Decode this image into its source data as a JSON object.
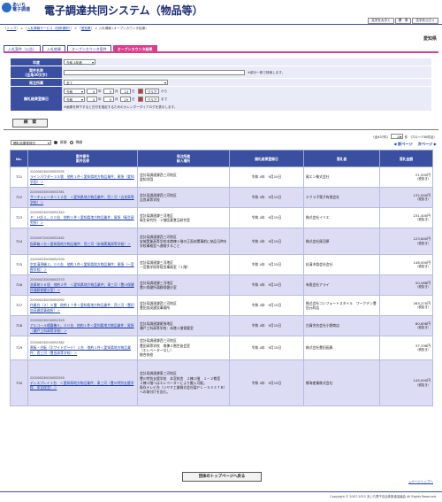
{
  "header": {
    "logo_line1": "あいち",
    "logo_line2": "電子調達",
    "title": "電子調達共同システム（物品等）",
    "font_buttons": [
      "文字を大きく",
      "標　準",
      "文字を小さく"
    ]
  },
  "breadcrumb": {
    "home": "トップ",
    "sep1": " > ",
    "service": "入札情報サービス（団体選択）",
    "sep2": " > ",
    "prefecture": "愛知県",
    "sep3": " > 入札情報 ",
    "current": "オープンカウンタ結果"
  },
  "region": "愛知県",
  "tabs": [
    "入札案件（公告）",
    "入札結果",
    "オープンカウンタ案件",
    "オープンカウンタ結果"
  ],
  "search": {
    "labels": {
      "year": "年度",
      "case_name": "案件名称",
      "case_name_sub": "(全角30文字)",
      "org": "発注所属",
      "date": "開札結果登録日"
    },
    "year_value": "令和 4年度",
    "case_name_note": "※部分一致で検索します。",
    "org_value": "全て",
    "date_from": {
      "era": "令和",
      "y": "4",
      "y_unit": "年",
      "m": "9",
      "m_unit": "月",
      "d": "13",
      "d_unit": "日",
      "clear": "クリア",
      "suffix": "から"
    },
    "date_to": {
      "era": "令和",
      "y": "4",
      "y_unit": "年",
      "m": "9",
      "m_unit": "月",
      "d": "29",
      "d_unit": "日",
      "clear": "クリア",
      "suffix": "まで"
    },
    "date_note": "※画像を押下すると日付を指定するためのカレンダーダイアログを表示します。",
    "button": "検　索"
  },
  "sort": {
    "field": "開札結果登録日",
    "asc": "昇順",
    "desc": "降順"
  },
  "paging": {
    "count": "（全437件）",
    "per_page": "10",
    "per_page_unit": "件",
    "range": "（721～730件目）",
    "prev": "前ページ",
    "next": "次ページ"
  },
  "table": {
    "headers": [
      "No.",
      "案件番号\n案件名称",
      "発注所属\n納入場所",
      "開札結果登録日",
      "落札者",
      "落札金額"
    ],
    "rows": [
      {
        "no": "721",
        "id": "220000230000053935",
        "name": "ラインパウダー３５袋　他約１件＜愛知県地方物品業件；尾張（愛知学園）＞",
        "org": "会計局調達課西三河地区\n愛知学園",
        "date": "令和 4年　9月15日",
        "winner": "尾エン株式会社",
        "amount": "21,000円",
        "note": "（税抜き）"
      },
      {
        "no": "722",
        "id": "220000230000052361",
        "name": "サーキュレーター１２台　＜愛知県地方物品業件；西三河（吉良高等学校）＞",
        "org": "会計局調達課西三河地区\n吉良高等学校",
        "date": "令和 4年　9月15日",
        "winner": "テクラ子電子有限会社",
        "amount": "132,000円",
        "note": "（税抜き）"
      },
      {
        "no": "723",
        "id": "220000230000052343",
        "name": "Ｐ：Ｈ計１，００台　他約１件＜愛知県地方物品業件；尾張（衛生研究所）＞",
        "org": "会計局調達課三河地区\n衛生研究所　２階医薬食品研究室",
        "date": "令和 4年　9月15日",
        "winner": "株式会社イリエ",
        "amount": "231,400円",
        "note": "（税抜き）"
      },
      {
        "no": "724",
        "id": "220000720000052462",
        "name": "指車箱１台＜愛知県地方物品業件；西三河（安城実業高等学校）＞",
        "org": "会計局調達課西三河地区\n安城実業高等学校本館棟１階の正面玄関事前に納品日時を学校事務室へ連絡すること",
        "date": "令和 4年　9月15日",
        "winner": "株式会社尾羽原",
        "amount": "123,840円",
        "note": "（税抜き）"
      },
      {
        "no": "725",
        "id": "220000230000052500",
        "name": "空気清浄機２，００台　他約１件＜愛知県地方物品業件；尾張（一宮聾学校）＞",
        "org": "会計局調達課三河地区\n一宮聾学校寄宿舎事務室（１階）",
        "date": "令和 4年　9月15日",
        "winner": "松清木県会社会社",
        "amount": "148,000円",
        "note": "（税抜き）"
      },
      {
        "no": "726",
        "id": "220000230000052570",
        "name": "洗車剤３６個　他約２件　＜愛知県地方物品業件；東三河（豊川保健所蒲郡保健分室）＞",
        "org": "会計局調達課三河地区\n豊川保健所蒲郡保健分室",
        "date": "令和 4年　9月15日",
        "winner": "有限会社アライ",
        "amount": "50,468円",
        "note": "（税抜き）"
      },
      {
        "no": "727",
        "id": "220000230000052092",
        "name": "作業台（２）６番　他約１７件＜愛知県地方物品業件；西三河（豊田加茂建設事務所）＞",
        "org": "会計局調達課西三河地区\n豊田加茂建設事務所",
        "date": "令和 4年　9月15日",
        "winner": "株式会社コンフォートスタイル　ワークチン豊田元町店",
        "amount": "263,270円",
        "note": "（税抜き）"
      },
      {
        "no": "728",
        "id": "220000230000052329",
        "name": "アルコール噴霧機５，００台　他約１件＜愛知県地方物品業件；尾張（瀬戸工科高等学校）＞",
        "org": "会計局調達課尾張地区\n瀬戸工科高等学校：本館１階保健室",
        "date": "令和 4年　9月15日",
        "winner": "古賀合名会社小野商店",
        "amount": "80,608円",
        "note": "（税抜き）"
      },
      {
        "no": "729",
        "id": "220000230000052382",
        "name": "黒板・白板（ホワイトボード）１台　他約１件＜愛知県地方物品業件；西三河（豊田高等学校）＞",
        "org": "会計局調達課西三河地区\n豊田高等学校　南棟２階生徒会室\n（エレベーターなし）\n総合各校",
        "date": "令和 4年　9月15日",
        "winner": "株式会社豊田画廊",
        "amount": "37,338円",
        "note": "（税抜き）"
      },
      {
        "no": "730",
        "id": "220000230000052593",
        "name": "ディスプレイ１台　＜愛知県地方物品業件；東三河（豊川特別支援学校　本宮校舎）＞",
        "org": "会計局調達課東三河地区\n豊川特別支援学校　本宮校舎　２棟２階　１－２教室\n２棟２階へはエレベーターにより搬入可能。\n既存テレビ台（ハヤミ工業株式会社製ＰＬ－５３３７Ｂ）への取付けを含む。",
        "date": "令和 4年　9月15日",
        "winner": "郷海産業株式会社",
        "amount": "145,000円",
        "note": "（税抜き）"
      }
    ]
  },
  "footer": {
    "top_button": "団体のトップページへ戻る",
    "page_top": "△ページトップへ",
    "copyright": "Copyright © 2007-2022 あいち電子自治体推進協議会 All Rights Reserved."
  }
}
